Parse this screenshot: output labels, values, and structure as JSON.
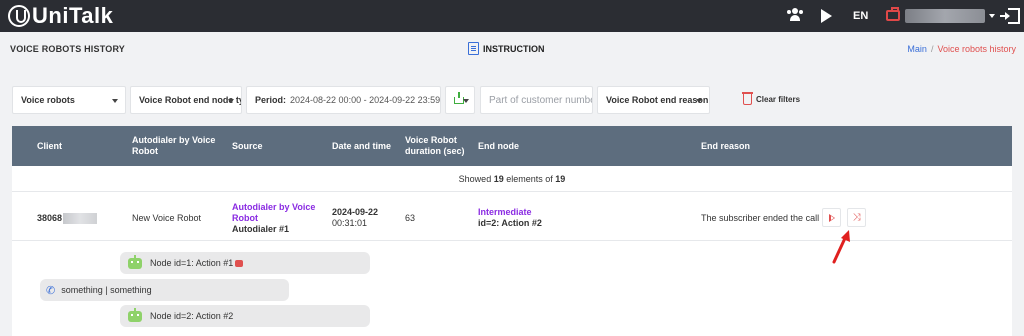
{
  "topbar": {
    "brand": "UniTalk",
    "lang": "EN"
  },
  "header": {
    "page_title": "VOICE ROBOTS HISTORY",
    "instruction_label": "INSTRUCTION",
    "breadcrumb": {
      "home": "Main",
      "separator": "/",
      "current": "Voice robots history"
    }
  },
  "filters": {
    "voice_robots": "Voice robots",
    "end_node_type": "Voice Robot end node ty",
    "period_label": "Period:",
    "period_value": "2024-08-22 00:00 - 2024-09-22 23:59",
    "customer_number_placeholder": "Part of customer number",
    "end_reason": "Voice Robot end reason",
    "clear_filters": "Clear filters"
  },
  "table": {
    "headers": {
      "client": "Client",
      "autodialer": "Autodialer by Voice Robot",
      "source": "Source",
      "datetime": "Date and time",
      "duration": "Voice Robot duration (sec)",
      "end_node": "End node",
      "end_reason": "End reason"
    },
    "summary": {
      "prefix": "Showed",
      "count": "19",
      "middle": "elements of",
      "total": "19"
    },
    "row": {
      "client": "38068",
      "autodialer": "New Voice Robot",
      "source_type": "Autodialer by Voice Robot",
      "source_name": "Autodialer #1",
      "date": "2024-09-22",
      "time": "00:31:01",
      "duration": "63",
      "end_node_type": "Intermediate",
      "end_node_name": "id=2: Action #2",
      "end_reason": "The subscriber ended the call"
    }
  },
  "conversation": [
    {
      "speaker": "robot",
      "text": "Node id=1: Action #1"
    },
    {
      "speaker": "customer",
      "text": "something | something"
    },
    {
      "speaker": "robot",
      "text": "Node id=2: Action #2"
    }
  ],
  "colors": {
    "topbar_bg": "#2b2d33",
    "table_header_bg": "#5d6d7e",
    "accent_red": "#e0504f",
    "accent_purple": "#8a2be2",
    "link_blue": "#3a6fd8",
    "robot_green": "#8fd26a"
  }
}
